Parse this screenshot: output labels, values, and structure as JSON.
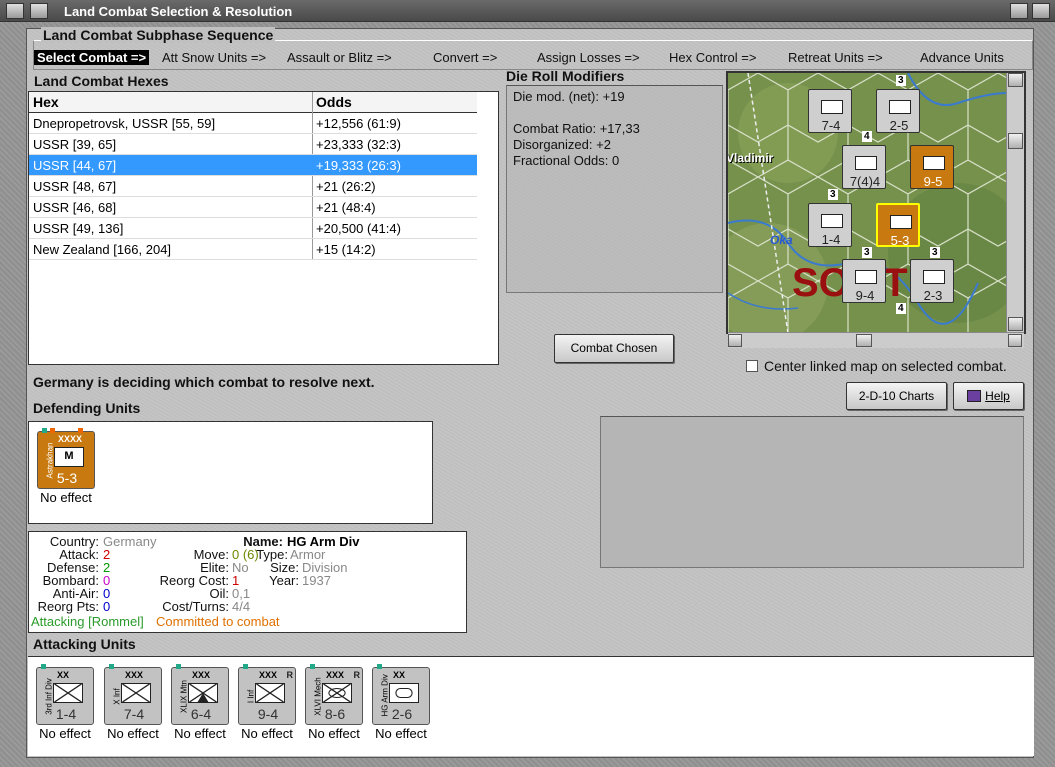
{
  "window": {
    "title": "Land Combat Selection & Resolution"
  },
  "subphase": {
    "label": "Land Combat Subphase Sequence",
    "steps": [
      "Select Combat =>",
      "Att Snow Units =>",
      "Assault or Blitz =>",
      "Convert =>",
      "Assign Losses =>",
      "Hex Control =>",
      "Retreat Units =>",
      "Advance Units"
    ],
    "active_index": 0
  },
  "hexes": {
    "label": "Land Combat Hexes",
    "columns": [
      "Hex",
      "Odds"
    ],
    "rows": [
      [
        "Dnepropetrovsk, USSR [55, 59]",
        "+12,556 (61:9)"
      ],
      [
        "USSR [39, 65]",
        "+23,333 (32:3)"
      ],
      [
        "USSR [44, 67]",
        "+19,333 (26:3)"
      ],
      [
        "USSR [48, 67]",
        "+21 (26:2)"
      ],
      [
        "USSR [46, 68]",
        "+21 (48:4)"
      ],
      [
        "USSR [49, 136]",
        "+20,500 (41:4)"
      ],
      [
        "New Zealand [166, 204]",
        "+15 (14:2)"
      ]
    ],
    "selected_index": 2
  },
  "die_roll": {
    "label": "Die Roll Modifiers",
    "lines": [
      "Die mod. (net): +19",
      "",
      "Combat Ratio: +17,33",
      "Disorganized: +2",
      "Fractional Odds: 0"
    ]
  },
  "map": {
    "labels": {
      "city": "Vladimir",
      "river": "Oka",
      "region": "SO   T U"
    },
    "units": [
      {
        "value": "7-4",
        "color": "gray"
      },
      {
        "value": "2-5",
        "color": "gray"
      },
      {
        "value": "7(4)4",
        "color": "gray"
      },
      {
        "value": "9-5",
        "color": "orange"
      },
      {
        "value": "1-4",
        "color": "gray"
      },
      {
        "value": "5-3",
        "color": "orange"
      },
      {
        "value": "9-4",
        "color": "gray"
      },
      {
        "value": "2-3",
        "color": "gray"
      }
    ],
    "stack_marks": [
      "3",
      "4",
      "3",
      "3",
      "3",
      "4"
    ]
  },
  "buttons": {
    "combat_chosen": "Combat Chosen",
    "charts": "2-D-10 Charts",
    "help": "Help"
  },
  "center_map": {
    "label": "Center linked map on selected combat.",
    "checked": false
  },
  "status": "Germany is deciding which combat to resolve next.",
  "defending": {
    "label": "Defending Units",
    "units": [
      {
        "name": "Astrakhan",
        "size": "XXXX",
        "symbol": "M",
        "strength": "5-3",
        "color": "orange",
        "effect": "No effect"
      }
    ]
  },
  "unit_info": {
    "country_label": "Country:",
    "country": "Germany",
    "attack_label": "Attack:",
    "attack": "2",
    "defense_label": "Defense:",
    "defense": "2",
    "bombard_label": "Bombard:",
    "bombard": "0",
    "antiair_label": "Anti-Air:",
    "antiair": "0",
    "reorg_pts_label": "Reorg Pts:",
    "reorg_pts": "0",
    "move_label": "Move:",
    "move": "0 (6)",
    "elite_label": "Elite:",
    "elite": "No",
    "reorg_cost_label": "Reorg Cost:",
    "reorg_cost": "1",
    "oil_label": "Oil:",
    "oil": "0,1",
    "cost_turns_label": "Cost/Turns:",
    "cost_turns": "4/4",
    "name_label": "Name:",
    "name": "HG Arm Div",
    "type_label": "Type:",
    "type": "Armor",
    "size_label": "Size:",
    "size": "Division",
    "year_label": "Year:",
    "year": "1937",
    "attacking_note": "Attacking [Rommel]",
    "committed_note": "Committed to combat",
    "colors": {
      "attack": "#d00000",
      "defense": "#009900",
      "bombard": "#cc00cc",
      "antiair": "#0000cc",
      "note_green": "#2a9a2a",
      "note_orange": "#e07000",
      "gray": "#888888"
    }
  },
  "attacking": {
    "label": "Attacking Units",
    "units": [
      {
        "name": "3rd Inf Div",
        "size": "XX",
        "strength": "1-4",
        "effect": "No effect",
        "badge": ""
      },
      {
        "name": "X Inf",
        "size": "XXX",
        "strength": "7-4",
        "effect": "No effect",
        "badge": ""
      },
      {
        "name": "XLIX Mtn",
        "size": "XXX",
        "strength": "6-4",
        "effect": "No effect",
        "badge": ""
      },
      {
        "name": "I Inf",
        "size": "XXX",
        "strength": "9-4",
        "effect": "No effect",
        "badge": "R"
      },
      {
        "name": "XLVI Mech",
        "size": "XXX",
        "strength": "8-6",
        "effect": "No effect",
        "badge": "R"
      },
      {
        "name": "HG Arm Div",
        "size": "XX",
        "strength": "2-6",
        "effect": "No effect",
        "badge": ""
      }
    ]
  }
}
